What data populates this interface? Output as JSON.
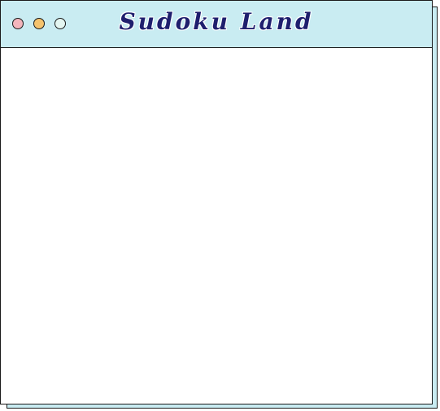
{
  "window": {
    "title": "Sudoku Land",
    "controls": [
      {
        "icon": "close-dot",
        "color": "#f3b5bc"
      },
      {
        "icon": "minimize-dot",
        "color": "#f5c36e"
      },
      {
        "icon": "maximize-dot",
        "color": "#e4f6f1"
      }
    ],
    "titlebar_color": "#c9ecf2",
    "title_color": "#1f1f6e"
  }
}
